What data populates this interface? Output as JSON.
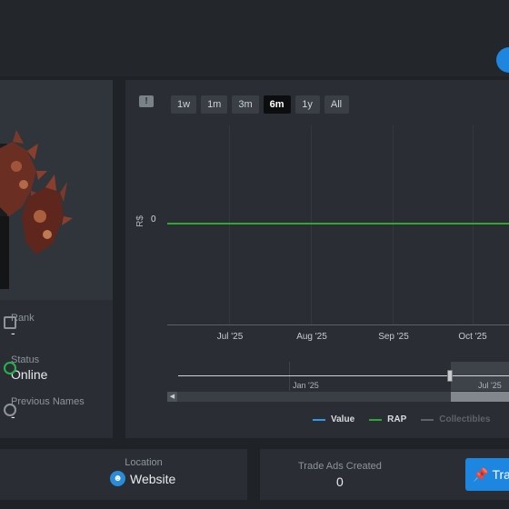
{
  "profile": {
    "rank_label": "Rank",
    "rank_value": "-",
    "status_label": "Status",
    "status_value": "Online",
    "previous_names_label": "Previous Names",
    "previous_names_value": "-"
  },
  "chart_controls": {
    "timeframes": [
      "1w",
      "1m",
      "3m",
      "6m",
      "1y",
      "All"
    ],
    "active": "6m"
  },
  "chart_data": {
    "type": "line",
    "ylabel": "R$",
    "yticks": [
      "0"
    ],
    "x_tick_labels": [
      "Jul '25",
      "Aug '25",
      "Sep '25",
      "Oct '25"
    ],
    "series": [
      {
        "name": "Value",
        "color": "#2b9be8",
        "values": [
          0,
          0,
          0,
          0
        ]
      },
      {
        "name": "RAP",
        "color": "#2fa832",
        "values": [
          0,
          0,
          0,
          0
        ]
      },
      {
        "name": "Collectibles",
        "color": "#5e6369",
        "values": []
      }
    ],
    "navigator_labels": [
      "Jan '25",
      "Jul '25"
    ],
    "legend_position": "bottom"
  },
  "bottom": {
    "location_label": "Location",
    "location_value": "Website",
    "trade_ads_label": "Trade Ads Created",
    "trade_ads_value": "0",
    "trade_button_label": "Tra"
  },
  "colors": {
    "accent": "#1d86e0",
    "online": "#25b34a",
    "rap_line": "#2fa832"
  },
  "icons": [
    "chat-note-icon",
    "rank-icon",
    "status-online-icon",
    "previous-names-icon",
    "user-location-icon",
    "pin-icon",
    "scroll-left-arrow-icon"
  ]
}
